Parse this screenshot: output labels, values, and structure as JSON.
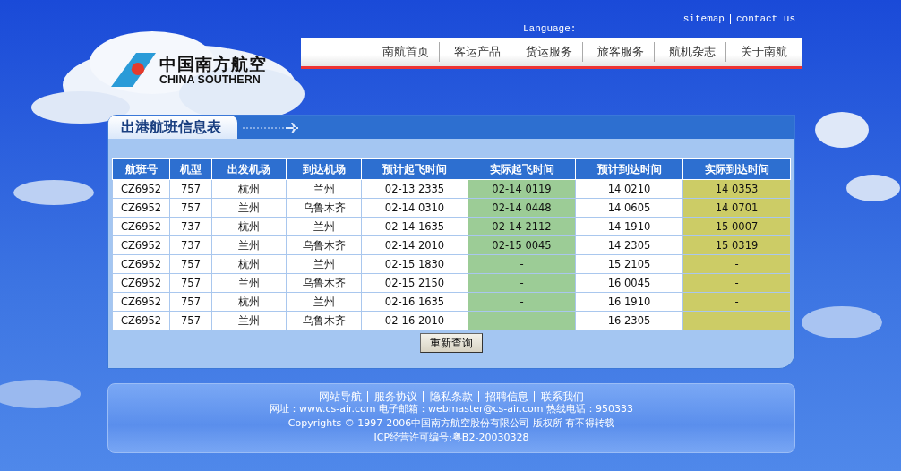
{
  "header": {
    "logo": {
      "name_cn": "中国南方航空",
      "name_en": "CHINA SOUTHERN"
    },
    "language_label": "Language:",
    "top_links": [
      "sitemap",
      "contact us"
    ],
    "nav": [
      "南航首页",
      "客运产品",
      "货运服务",
      "旅客服务",
      "航机杂志",
      "关于南航"
    ]
  },
  "panel": {
    "title": "出港航班信息表",
    "table": {
      "columns": [
        "航班号",
        "机型",
        "出发机场",
        "到达机场",
        "预计起飞时间",
        "实际起飞时间",
        "预计到达时间",
        "实际到达时间"
      ],
      "rows": [
        [
          "CZ6952",
          "757",
          "杭州",
          "兰州",
          "02-13 2335",
          "02-14 0119",
          "14 0210",
          "14 0353"
        ],
        [
          "CZ6952",
          "757",
          "兰州",
          "乌鲁木齐",
          "02-14 0310",
          "02-14 0448",
          "14 0605",
          "14 0701"
        ],
        [
          "CZ6952",
          "737",
          "杭州",
          "兰州",
          "02-14 1635",
          "02-14 2112",
          "14 1910",
          "15 0007"
        ],
        [
          "CZ6952",
          "737",
          "兰州",
          "乌鲁木齐",
          "02-14 2010",
          "02-15 0045",
          "14 2305",
          "15 0319"
        ],
        [
          "CZ6952",
          "757",
          "杭州",
          "兰州",
          "02-15 1830",
          "-",
          "15 2105",
          "-"
        ],
        [
          "CZ6952",
          "757",
          "兰州",
          "乌鲁木齐",
          "02-15 2150",
          "-",
          "16 0045",
          "-"
        ],
        [
          "CZ6952",
          "757",
          "杭州",
          "兰州",
          "02-16 1635",
          "-",
          "16 1910",
          "-"
        ],
        [
          "CZ6952",
          "757",
          "兰州",
          "乌鲁木齐",
          "02-16 2010",
          "-",
          "16 2305",
          "-"
        ]
      ]
    },
    "button": "重新查询"
  },
  "footer": {
    "links": [
      "网站导航",
      "服务协议",
      "隐私条款",
      "招聘信息",
      "联系我们"
    ],
    "contact": "网址：www.cs-air.com 电子邮箱：webmaster@cs-air.com 热线电话：950333",
    "copyright": "Copyrights © 1997-2006中国南方航空股份有限公司 版权所 有不得转载",
    "icp": "ICP经营许可编号:粤B2-20030328"
  }
}
